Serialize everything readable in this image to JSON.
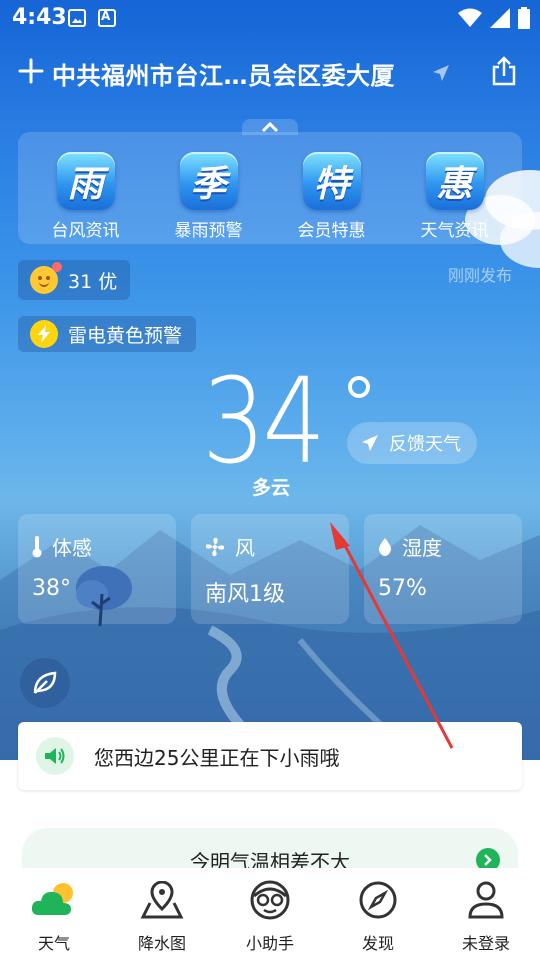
{
  "status_bar": {
    "time": "4:43",
    "icons": [
      "image-icon",
      "a-box-icon",
      "wifi-icon",
      "signal-icon",
      "battery-icon"
    ]
  },
  "header": {
    "location": "中共福州市台江…员会区委大厦",
    "icons": [
      "add-icon",
      "location-arrow-icon",
      "share-icon"
    ]
  },
  "features": [
    {
      "icon_char": "雨",
      "label": "台风资讯"
    },
    {
      "icon_char": "季",
      "label": "暴雨预警"
    },
    {
      "icon_char": "特",
      "label": "会员特惠"
    },
    {
      "icon_char": "惠",
      "label": "天气资讯"
    }
  ],
  "aqi": {
    "value": "31 优"
  },
  "published": "刚刚发布",
  "warning": {
    "text": "雷电黄色预警"
  },
  "weather": {
    "temperature": "34",
    "condition": "多云"
  },
  "feedback_button": {
    "label": "反馈天气"
  },
  "stats": [
    {
      "label": "体感",
      "value": "38°",
      "icon": "thermometer-icon"
    },
    {
      "label": "风",
      "value": "南风1级",
      "icon": "fan-icon"
    },
    {
      "label": "湿度",
      "value": "57%",
      "icon": "droplet-icon"
    }
  ],
  "notice": {
    "text": "您西边25公里正在下小雨哦"
  },
  "tip": {
    "text": "今明气温相差不大"
  },
  "bottom_nav": [
    {
      "label": "天气",
      "icon": "weather-icon"
    },
    {
      "label": "降水图",
      "icon": "map-pin-icon"
    },
    {
      "label": "小助手",
      "icon": "assistant-icon"
    },
    {
      "label": "发现",
      "icon": "compass-icon"
    },
    {
      "label": "未登录",
      "icon": "user-icon"
    }
  ],
  "colors": {
    "sky_top": "#1565d6",
    "sky_bottom": "#3b78b5",
    "accent_green": "#1fb45a",
    "annotation_arrow": "#e53935"
  }
}
